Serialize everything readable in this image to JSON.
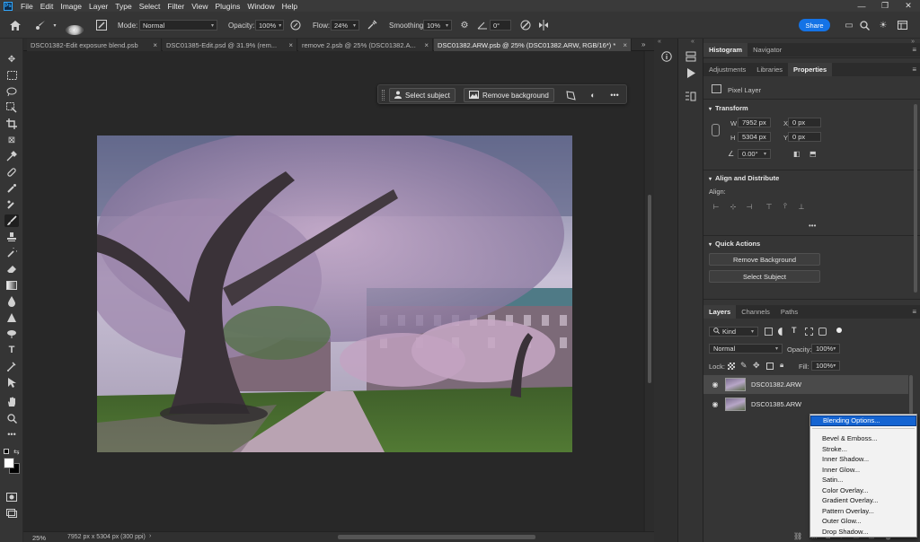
{
  "app": {
    "menu": [
      "File",
      "Edit",
      "Image",
      "Layer",
      "Type",
      "Select",
      "Filter",
      "View",
      "Plugins",
      "Window",
      "Help"
    ],
    "logo": "Ps"
  },
  "options": {
    "brush_size": "900",
    "mode_label": "Mode:",
    "mode_value": "Normal",
    "opacity_label": "Opacity:",
    "opacity_value": "100%",
    "flow_label": "Flow:",
    "flow_value": "24%",
    "smoothing_label": "Smoothing:",
    "smoothing_value": "10%",
    "angle_value": "0°",
    "share_label": "Share"
  },
  "tabs": [
    {
      "label": "DSC01382-Edit exposure blend.psb"
    },
    {
      "label": "DSC01385-Edit.psd @ 31.9% (rem..."
    },
    {
      "label": "remove 2.psb @ 25% (DSC01382.A..."
    },
    {
      "label": "DSC01382.ARW.psb @ 25% (DSC01382.ARW, RGB/16*) *"
    }
  ],
  "taskbar": {
    "select_subject": "Select subject",
    "remove_background": "Remove background",
    "more": "•••"
  },
  "status": {
    "zoom": "25%",
    "doc_info": "7952 px x 5304 px (300 ppi)"
  },
  "panels": {
    "top_tabs": [
      "Histogram",
      "Navigator"
    ],
    "mid_tabs": [
      "Adjustments",
      "Libraries",
      "Properties"
    ],
    "layer_type": "Pixel Layer",
    "transform_title": "Transform",
    "w_label": "W",
    "w_value": "7952 px",
    "h_label": "H",
    "h_value": "5304 px",
    "x_label": "X",
    "x_value": "0 px",
    "y_label": "Y",
    "y_value": "0 px",
    "angle_value": "0.00°",
    "align_title": "Align and Distribute",
    "align_label": "Align:",
    "align_more": "•••",
    "quick_title": "Quick Actions",
    "remove_bg_btn": "Remove Background",
    "select_subject_btn": "Select Subject",
    "layer_tabs": [
      "Layers",
      "Channels",
      "Paths"
    ],
    "kind_value": "Kind",
    "blend_value": "Normal",
    "opacity_label": "Opacity:",
    "opacity_value": "100%",
    "lock_label": "Lock:",
    "fill_label": "Fill:",
    "fill_value": "100%",
    "layers": [
      {
        "name": "DSC01382.ARW",
        "selected": true
      },
      {
        "name": "DSC01385.ARW",
        "selected": false
      }
    ]
  },
  "context_menu": {
    "items": [
      "Blending Options...",
      "Bevel & Emboss...",
      "Stroke...",
      "Inner Shadow...",
      "Inner Glow...",
      "Satin...",
      "Color Overlay...",
      "Gradient Overlay...",
      "Pattern Overlay...",
      "Outer Glow...",
      "Drop Shadow..."
    ],
    "highlighted": "Blending Options..."
  },
  "colors": {
    "accent": "#1473e6",
    "highlight": "#1464d2",
    "panel_bg": "#353535",
    "canvas_bg": "#282828"
  }
}
